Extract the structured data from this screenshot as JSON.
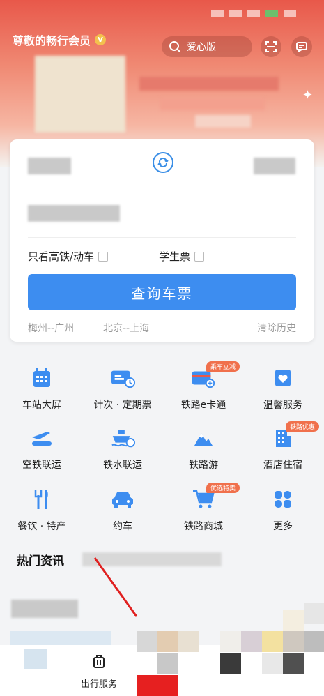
{
  "header": {
    "member_title": "尊敬的畅行会员",
    "member_badge": "V",
    "search_label": "爱心版"
  },
  "booking": {
    "high_speed_label": "只看高铁/动车",
    "student_label": "学生票",
    "query_button": "查询车票",
    "history": [
      "梅州--广州",
      "北京--上海"
    ],
    "clear_history": "清除历史"
  },
  "services": [
    {
      "label": "车站大屏",
      "icon": "station-screen-icon",
      "tag": ""
    },
    {
      "label": "计次 · 定期票",
      "icon": "ticket-pass-icon",
      "tag": ""
    },
    {
      "label": "铁路e卡通",
      "icon": "ecard-icon",
      "tag": "乘车立减"
    },
    {
      "label": "温馨服务",
      "icon": "heart-service-icon",
      "tag": ""
    },
    {
      "label": "空铁联运",
      "icon": "air-rail-icon",
      "tag": ""
    },
    {
      "label": "铁水联运",
      "icon": "ship-rail-icon",
      "tag": ""
    },
    {
      "label": "铁路游",
      "icon": "mountain-icon",
      "tag": ""
    },
    {
      "label": "酒店住宿",
      "icon": "hotel-icon",
      "tag": "铁路优惠"
    },
    {
      "label": "餐饮 · 特产",
      "icon": "dining-icon",
      "tag": ""
    },
    {
      "label": "约车",
      "icon": "car-icon",
      "tag": ""
    },
    {
      "label": "铁路商城",
      "icon": "cart-icon",
      "tag": "优选特卖"
    },
    {
      "label": "更多",
      "icon": "more-grid-icon",
      "tag": ""
    }
  ],
  "news": {
    "title": "热门资讯"
  },
  "bottom_nav": {
    "service_label": "出行服务"
  },
  "colors": {
    "accent": "#3d8df0",
    "header": "#e8584a",
    "tag": "#f0704c"
  }
}
